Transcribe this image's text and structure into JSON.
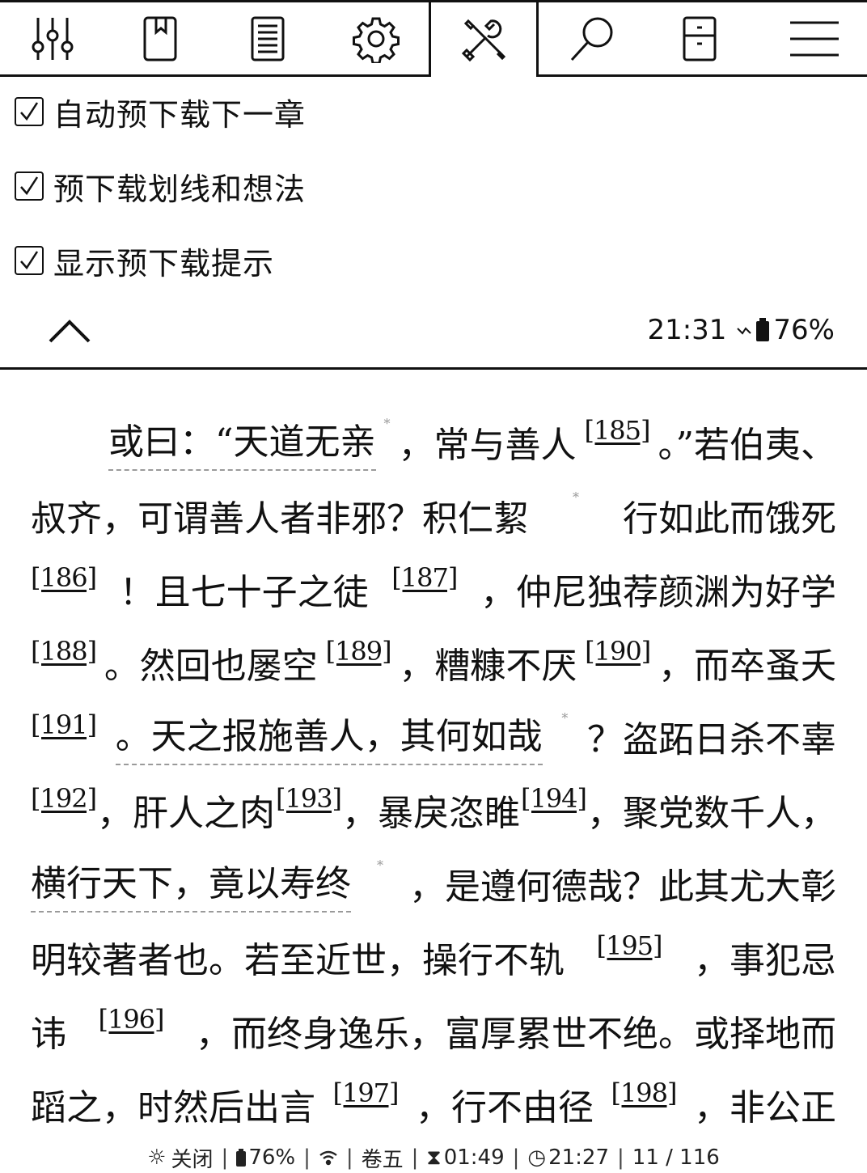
{
  "toolbar": {
    "icons": [
      "sliders-icon",
      "bookmark-icon",
      "contents-icon",
      "gear-icon",
      "tools-icon",
      "search-icon",
      "device-icon",
      "menu-icon"
    ],
    "active": "tools-icon"
  },
  "menu": {
    "options": [
      {
        "label": "自动预下载下一章",
        "checked": true
      },
      {
        "label": "预下载划线和想法",
        "checked": true
      },
      {
        "label": "显示预下载提示",
        "checked": true
      }
    ]
  },
  "status_top": {
    "time": "21:31",
    "battery": "76%"
  },
  "reader": {
    "lines": [
      [
        "或曰：“天道无亲",
        "，常与善人",
        "[185]",
        "。”若伯夷、"
      ],
      [
        "叔齐，可谓善人者非邪？积仁絜",
        "行如此而饿死"
      ],
      [
        "[186]",
        "！且七十子之徒",
        "[187]",
        "，仲尼独荐颜渊为好学"
      ],
      [
        "[188]",
        "。然回也屡空",
        "[189]",
        "，糟糠不厌",
        "[190]",
        "，而卒蚤夭"
      ],
      [
        "[191]",
        "。天之报施善人，其何如哉",
        "？盗跖日杀不辜"
      ],
      [
        "[192]",
        "，肝人之肉",
        "[193]",
        "，暴戾恣睢",
        "[194]",
        "，聚党数千人，"
      ],
      [
        "横行天下，竟以寿终",
        "，是遵何德哉？此其尤大彰"
      ],
      [
        "明较著者也。若至近世，操行不轨",
        "[195]",
        "，事犯忌"
      ],
      [
        "讳",
        "[196]",
        "，而终身逸乐，富厚累世不绝。或择地而"
      ],
      [
        "蹈之，时然后出言",
        "[197]",
        "，行不由径",
        "[198]",
        "，非公正"
      ]
    ]
  },
  "footer": {
    "light": "关闭",
    "battery": "76%",
    "chapter": "卷五",
    "time_left": "01:49",
    "clock": "21:27",
    "page": "11 / 116"
  }
}
